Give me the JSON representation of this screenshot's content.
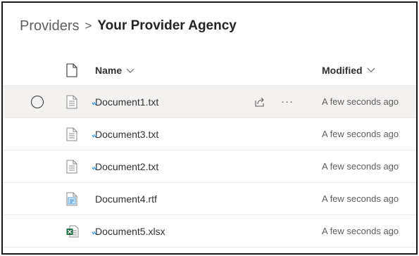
{
  "breadcrumb": {
    "root": "Providers",
    "separator": ">",
    "current": "Your Provider Agency"
  },
  "columns": {
    "name": "Name",
    "modified": "Modified",
    "sort_icon": "chevron-down-icon",
    "type_icon": "document-icon"
  },
  "files": [
    {
      "name": "Document1.txt",
      "modified": "A few seconds ago",
      "icon": "txt-file-icon",
      "is_new": true,
      "selected": true
    },
    {
      "name": "Document3.txt",
      "modified": "A few seconds ago",
      "icon": "txt-file-icon",
      "is_new": true,
      "selected": false
    },
    {
      "name": "Document2.txt",
      "modified": "A few seconds ago",
      "icon": "txt-file-icon",
      "is_new": true,
      "selected": false
    },
    {
      "name": "Document4.rtf",
      "modified": "A few seconds ago",
      "icon": "rtf-file-icon",
      "is_new": false,
      "selected": false
    },
    {
      "name": "Document5.xlsx",
      "modified": "A few seconds ago",
      "icon": "excel-file-icon",
      "is_new": true,
      "selected": false
    }
  ],
  "row_actions": {
    "share_icon": "share-icon",
    "more_label": "···"
  },
  "colors": {
    "new_indicator": "#2b88d8",
    "excel": "#1d6f42",
    "selected_row": "#f3f2f1"
  }
}
